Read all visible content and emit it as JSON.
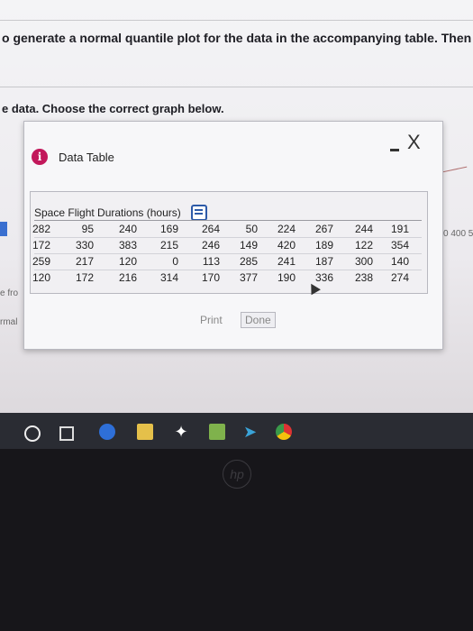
{
  "question": {
    "text": "o generate a normal quantile plot for the data in the accompanying table. Then determine whethe"
  },
  "instruction": {
    "text": "e data. Choose the correct graph below."
  },
  "peek": {
    "left_label_1": "e fro",
    "left_label_2": "rmal",
    "right_axis": "0 400 5"
  },
  "dialog": {
    "title": "Data Table",
    "info_icon": "info-icon",
    "minimize_icon": "minimize-icon",
    "close_label": "X",
    "table": {
      "caption": "Space Flight Durations (hours)",
      "rows": [
        [
          "282",
          "95",
          "240",
          "169",
          "264",
          "50",
          "224",
          "267",
          "244",
          "191"
        ],
        [
          "172",
          "330",
          "383",
          "215",
          "246",
          "149",
          "420",
          "189",
          "122",
          "354"
        ],
        [
          "259",
          "217",
          "120",
          "0",
          "113",
          "285",
          "241",
          "187",
          "300",
          "140"
        ],
        [
          "120",
          "172",
          "216",
          "314",
          "170",
          "377",
          "190",
          "336",
          "238",
          "274"
        ]
      ]
    },
    "print_label": "Print",
    "done_label": "Done"
  },
  "taskbar": {
    "icons": [
      "start-icon",
      "task-view-icon",
      "edge-icon",
      "store-icon",
      "dropbox-icon",
      "photos-icon",
      "arrow-icon",
      "chrome-icon"
    ]
  },
  "bezel": {
    "logo": "hp"
  }
}
